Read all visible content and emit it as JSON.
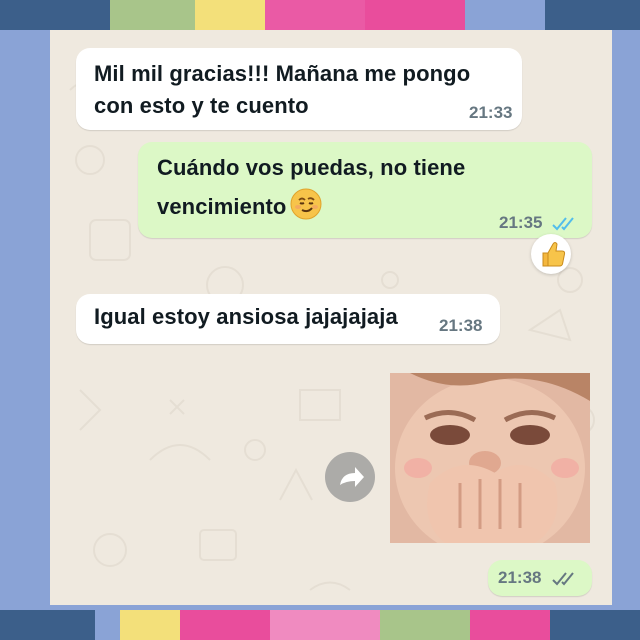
{
  "messages": [
    {
      "direction": "in",
      "text_line1": "Mil mil gracias!!! Mañana me pongo",
      "text_line2": "con esto y te cuento",
      "time": "21:33"
    },
    {
      "direction": "out",
      "text_line1": "Cuándo vos puedas, no tiene",
      "text_line2": "vencimiento",
      "emoji": "smirk-emoji",
      "time": "21:35",
      "status": "read",
      "reaction": "thumbs-up-emoji"
    },
    {
      "direction": "in",
      "text": "Igual estoy ansiosa jajajajaja",
      "time": "21:38"
    },
    {
      "direction": "out",
      "type": "sticker-image",
      "image": "laughing-child-covering-mouth",
      "time": "21:38",
      "status": "delivered",
      "forward_icon": "forward-icon"
    }
  ],
  "colors": {
    "frame": "#8aa3d6",
    "chat_background": "#efe9df",
    "incoming_bubble": "#ffffff",
    "outgoing_bubble": "#dcf8c6",
    "read_ticks": "#53bdeb",
    "sent_ticks": "#667781",
    "tape_pink": "#ea5aa5",
    "tape_green": "#a8c58a",
    "tape_yellow": "#f3e07a",
    "tape_navy": "#3c5f8a"
  }
}
